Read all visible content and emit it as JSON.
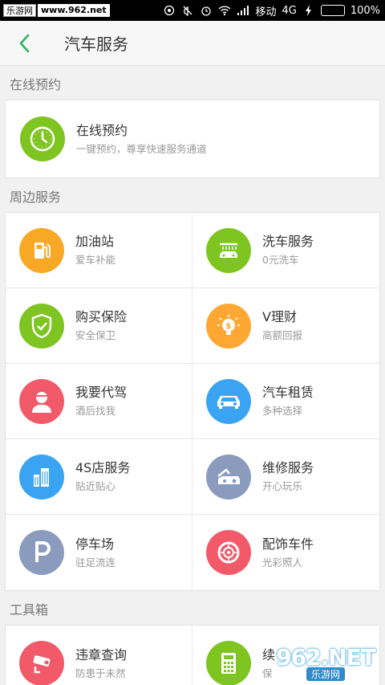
{
  "status_bar": {
    "brand": "乐游网",
    "url": "www.962.net",
    "carrier": "移动",
    "network": "4G",
    "battery": "100%",
    "battery_level": 1.0
  },
  "header": {
    "title": "汽车服务"
  },
  "sections": {
    "online": {
      "title": "在线预约",
      "item": {
        "name": "在线预约",
        "sub": "一键预约，尊享快速服务通道",
        "color": "#7fc522",
        "icon": "clock-icon"
      }
    },
    "nearby": {
      "title": "周边服务",
      "items": [
        {
          "name": "加油站",
          "sub": "爱车补能",
          "color": "#f9a825",
          "icon": "gas-station-icon"
        },
        {
          "name": "洗车服务",
          "sub": "0元洗车",
          "color": "#7fc522",
          "icon": "car-wash-icon"
        },
        {
          "name": "购买保险",
          "sub": "安全保卫",
          "color": "#7fc522",
          "icon": "shield-icon"
        },
        {
          "name": "V理财",
          "sub": "高额回报",
          "color": "#ffa733",
          "icon": "lightbulb-icon"
        },
        {
          "name": "我要代驾",
          "sub": "酒后找我",
          "color": "#f25a6a",
          "icon": "driver-icon"
        },
        {
          "name": "汽车租赁",
          "sub": "多种选择",
          "color": "#3ba4f2",
          "icon": "car-icon"
        },
        {
          "name": "4S店服务",
          "sub": "贴近贴心",
          "color": "#3ba4f2",
          "icon": "building-icon"
        },
        {
          "name": "维修服务",
          "sub": "开心玩乐",
          "color": "#8a9bbd",
          "icon": "repair-icon"
        },
        {
          "name": "停车场",
          "sub": "驻足流连",
          "color": "#8a9bbd",
          "icon": "parking-icon"
        },
        {
          "name": "配饰车件",
          "sub": "光彩照人",
          "color": "#f25a6a",
          "icon": "wheel-icon"
        }
      ]
    },
    "tools": {
      "title": "工具箱",
      "items": [
        {
          "name": "违章查询",
          "sub": "防患于未然",
          "color": "#f25a6a",
          "icon": "camera-icon"
        },
        {
          "name": "续",
          "sub": "保",
          "color": "#7fc522",
          "icon": "calculator-icon"
        }
      ]
    }
  },
  "watermark": {
    "big": "962.NET",
    "small": "乐游网"
  }
}
